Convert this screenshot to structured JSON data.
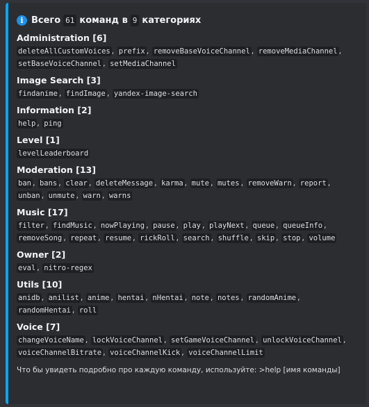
{
  "embed": {
    "accent_color": "#00a8fc",
    "title": {
      "icon": "info-icon",
      "prefix": "Всего",
      "total_commands": "61",
      "middle": "команд в",
      "total_categories": "9",
      "suffix": "категориях"
    },
    "categories": [
      {
        "label": "Administration [6]",
        "commands": [
          "deleteAllCustomVoices",
          "prefix",
          "removeBaseVoiceChannel",
          "removeMediaChannel",
          "setBaseVoiceChannel",
          "setMediaChannel"
        ]
      },
      {
        "label": "Image Search [3]",
        "commands": [
          "findanime",
          "findImage",
          "yandex-image-search"
        ]
      },
      {
        "label": "Information [2]",
        "commands": [
          "help",
          "ping"
        ]
      },
      {
        "label": "Level [1]",
        "commands": [
          "levelLeaderboard"
        ]
      },
      {
        "label": "Moderation [13]",
        "commands": [
          "ban",
          "bans",
          "clear",
          "deleteMessage",
          "karma",
          "mute",
          "mutes",
          "removeWarn",
          "report",
          "unban",
          "unmute",
          "warn",
          "warns"
        ]
      },
      {
        "label": "Music [17]",
        "commands": [
          "filter",
          "findMusic",
          "nowPlaying",
          "pause",
          "play",
          "playNext",
          "queue",
          "queueInfo",
          "removeSong",
          "repeat",
          "resume",
          "rickRoll",
          "search",
          "shuffle",
          "skip",
          "stop",
          "volume"
        ]
      },
      {
        "label": "Owner [2]",
        "commands": [
          "eval",
          "nitro-regex"
        ]
      },
      {
        "label": "Utils [10]",
        "commands": [
          "anidb",
          "anilist",
          "anime",
          "hentai",
          "nHentai",
          "note",
          "notes",
          "randomAnime",
          "randomHentai",
          "roll"
        ]
      },
      {
        "label": "Voice [7]",
        "commands": [
          "changeVoiceName",
          "lockVoiceChannel",
          "setGameVoiceChannel",
          "unlockVoiceChannel",
          "voiceChannelBitrate",
          "voiceChannelKick",
          "voiceChannelLimit"
        ]
      }
    ],
    "footer": "Что бы увидеть подробно про каждую команду, используйте: >help [имя команды]"
  }
}
